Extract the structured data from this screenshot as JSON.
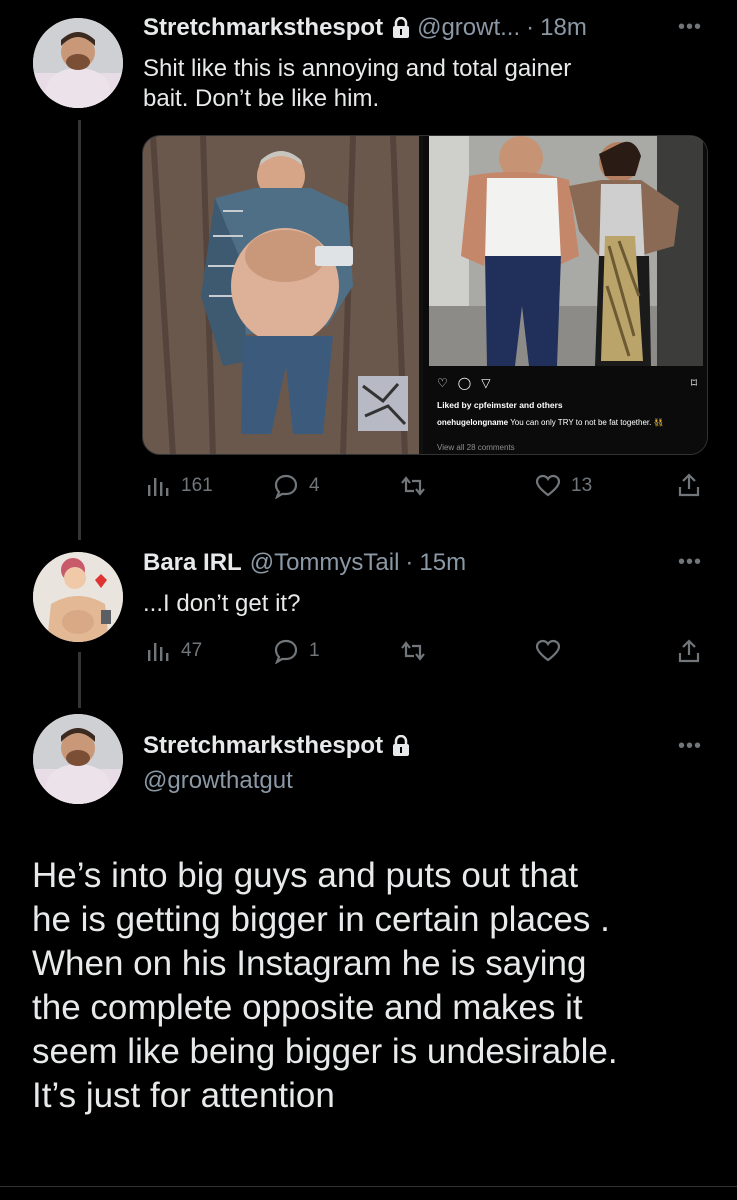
{
  "tweet1": {
    "display_name": "Stretchmarksthespot",
    "handle": "@growt...",
    "time": "18m",
    "text_line1": "Shit like this is annoying and total gainer",
    "text_line2": "bait. Don’t be like him.",
    "instagram": {
      "liked_by": "Liked by cpfeimster and others",
      "caption_user": "onehugelongname",
      "caption_text": "You can only TRY to not be fat together. 👯",
      "view_comments": "View all 28 comments"
    },
    "views": "161",
    "replies": "4",
    "retweets": "",
    "likes": "13"
  },
  "tweet2": {
    "display_name": "Bara IRL",
    "handle": "@TommysTail",
    "time": "15m",
    "text": "...I don’t get it?",
    "views": "47",
    "replies": "1",
    "retweets": "",
    "likes": ""
  },
  "tweet3": {
    "display_name": "Stretchmarksthespot",
    "handle": "@growthatgut",
    "text_lines": [
      "He’s into big guys and puts out that",
      "he is getting bigger in certain places .",
      "When on his Instagram he is saying",
      "the complete opposite and makes it",
      "seem like being bigger is undesirable.",
      "It’s just for attention"
    ]
  },
  "colors": {
    "background": "#000000",
    "text": "#e7e9ea",
    "secondary": "#71767b",
    "divider": "#2f3336"
  },
  "icons": {
    "more": "more-dots-icon",
    "lock": "lock-icon",
    "views": "views-bar-icon",
    "reply": "reply-bubble-icon",
    "retweet": "retweet-icon",
    "like": "heart-icon",
    "share": "share-icon"
  }
}
